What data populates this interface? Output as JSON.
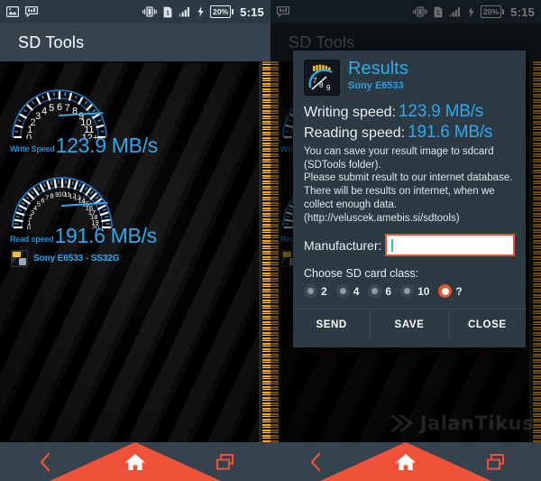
{
  "statusbar": {
    "icons_left": [
      "image-icon",
      "message-icon"
    ],
    "icons_right": [
      "vibrate-icon",
      "sim-card-icon",
      "signal-bars-icon",
      "charging-bolt-icon"
    ],
    "battery_percent": "20%",
    "sim_label": "1",
    "clock": "5:15"
  },
  "app": {
    "title_left": "SD Tools",
    "title_right": "SD Tools"
  },
  "left_panel": {
    "gauges": [
      {
        "name": "write-speed-gauge",
        "label": "Write Speed",
        "value": "123.9 MB/s",
        "ticks": [
          "0",
          "1",
          "2",
          "3",
          "4",
          "5",
          "6",
          "7",
          "8",
          "9",
          "10",
          "11",
          "12+"
        ],
        "needle_value": 11.6,
        "scale_max": 12
      },
      {
        "name": "read-speed-gauge",
        "label": "Read speed",
        "value": "191.6 MB/s",
        "ticks": [
          "0",
          "1",
          "2",
          "3",
          "4",
          "5",
          "6",
          "7",
          "8",
          "9",
          "10",
          "11",
          "12",
          "13",
          "14",
          "15",
          "16",
          "17",
          "18",
          "19",
          "20"
        ],
        "needle_value": 19.2,
        "scale_max": 20
      }
    ],
    "device": "Sony E6533 - SS32G"
  },
  "dialog": {
    "title": "Results",
    "subtitle": "Sony E6533",
    "writing_label": "Writing speed:",
    "writing_value": "123.9 MB/s",
    "reading_label": "Reading speed:",
    "reading_value": "191.6 MB/s",
    "note_lines": [
      "You can save your result image to sdcard",
      "(SDTools folder).",
      "Please submit result to our internet database.",
      "There will be results on internet, when we",
      "collect enough data.",
      "(http://veluscek.amebis.si/sdtools)"
    ],
    "manufacturer_label": "Manufacturer:",
    "manufacturer_value": "",
    "manufacturer_placeholder": "",
    "class_title": "Choose SD card class:",
    "class_options": [
      {
        "label": "2",
        "selected": false
      },
      {
        "label": "4",
        "selected": false
      },
      {
        "label": "6",
        "selected": false
      },
      {
        "label": "10",
        "selected": false
      },
      {
        "label": "?",
        "selected": true
      }
    ],
    "buttons": [
      "SEND",
      "SAVE",
      "CLOSE"
    ]
  },
  "navbar": {
    "back_icon": "back-chevron-icon",
    "home_icon": "home-icon",
    "recents_icon": "recents-icon"
  },
  "watermark": {
    "text": "JalanTikus",
    "logo": "jalantikus-logo-icon"
  },
  "colors": {
    "accent_blue": "#2ea8f0",
    "accent_orange": "#ef5239",
    "chrome": "#34434d",
    "statusbar": "#2b3a44",
    "dialog_bg": "#2c3a44"
  }
}
